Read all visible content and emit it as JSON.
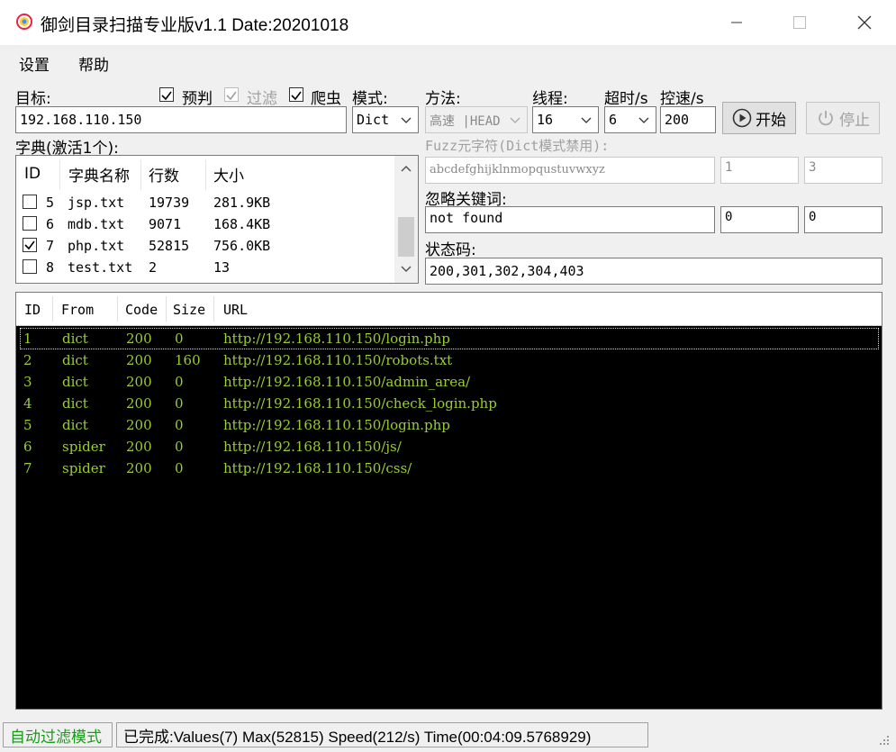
{
  "window": {
    "title": "御剑目录扫描专业版v1.1 Date:20201018"
  },
  "menu": [
    "设置",
    "帮助"
  ],
  "target": {
    "label": "目标:",
    "value": "192.168.110.150"
  },
  "options": {
    "prejudge": {
      "label": "预判",
      "checked": true
    },
    "filter": {
      "label": "过滤",
      "checked": true,
      "disabled": true
    },
    "crawler": {
      "label": "爬虫",
      "checked": true
    }
  },
  "mode": {
    "label": "模式:",
    "value": "Dict"
  },
  "method": {
    "label": "方法:",
    "value": "高速 |HEAD"
  },
  "threads": {
    "label": "线程:",
    "value": "16"
  },
  "timeout": {
    "label": "超时/s",
    "value": "6"
  },
  "speed": {
    "label": "控速/s",
    "value": "200"
  },
  "buttons": {
    "start": "开始",
    "stop": "停止"
  },
  "dict": {
    "label": "字典(激活1个):",
    "columns": [
      "ID",
      "字典名称",
      "行数",
      "大小"
    ],
    "rows": [
      {
        "checked": false,
        "id": "5",
        "name": "jsp.txt",
        "lines": "19739",
        "size": "281.9KB"
      },
      {
        "checked": false,
        "id": "6",
        "name": "mdb.txt",
        "lines": "9071",
        "size": "168.4KB"
      },
      {
        "checked": true,
        "id": "7",
        "name": "php.txt",
        "lines": "52815",
        "size": "756.0KB"
      },
      {
        "checked": false,
        "id": "8",
        "name": "test.txt",
        "lines": "2",
        "size": "13"
      }
    ]
  },
  "fuzz": {
    "label": "Fuzz元字符(Dict模式禁用):",
    "chars": "abcdefghijklnmopqustuvwxyz",
    "min": "1",
    "max": "3"
  },
  "ignore": {
    "label": "忽略关键词:",
    "value": "not found",
    "a": "0",
    "b": "0"
  },
  "statuscodes": {
    "label": "状态码:",
    "value": "200,301,302,304,403"
  },
  "results": {
    "columns": [
      "ID",
      "From",
      "Code",
      "Size",
      "URL"
    ],
    "rows": [
      {
        "id": "1",
        "from": "dict",
        "code": "200",
        "size": "0",
        "url": "http://192.168.110.150/login.php"
      },
      {
        "id": "2",
        "from": "dict",
        "code": "200",
        "size": "160",
        "url": "http://192.168.110.150/robots.txt"
      },
      {
        "id": "3",
        "from": "dict",
        "code": "200",
        "size": "0",
        "url": "http://192.168.110.150/admin_area/"
      },
      {
        "id": "4",
        "from": "dict",
        "code": "200",
        "size": "0",
        "url": "http://192.168.110.150/check_login.php"
      },
      {
        "id": "5",
        "from": "dict",
        "code": "200",
        "size": "0",
        "url": "http://192.168.110.150/login.php"
      },
      {
        "id": "6",
        "from": "spider",
        "code": "200",
        "size": "0",
        "url": "http://192.168.110.150/js/"
      },
      {
        "id": "7",
        "from": "spider",
        "code": "200",
        "size": "0",
        "url": "http://192.168.110.150/css/"
      }
    ]
  },
  "status": {
    "mode": "自动过滤模式",
    "summary": "已完成:Values(7) Max(52815) Speed(212/s) Time(00:04:09.5768929)"
  },
  "colors": {
    "result_text": "#9acd32",
    "status_mode": "#1a9a1a",
    "results_bg": "#000000"
  }
}
